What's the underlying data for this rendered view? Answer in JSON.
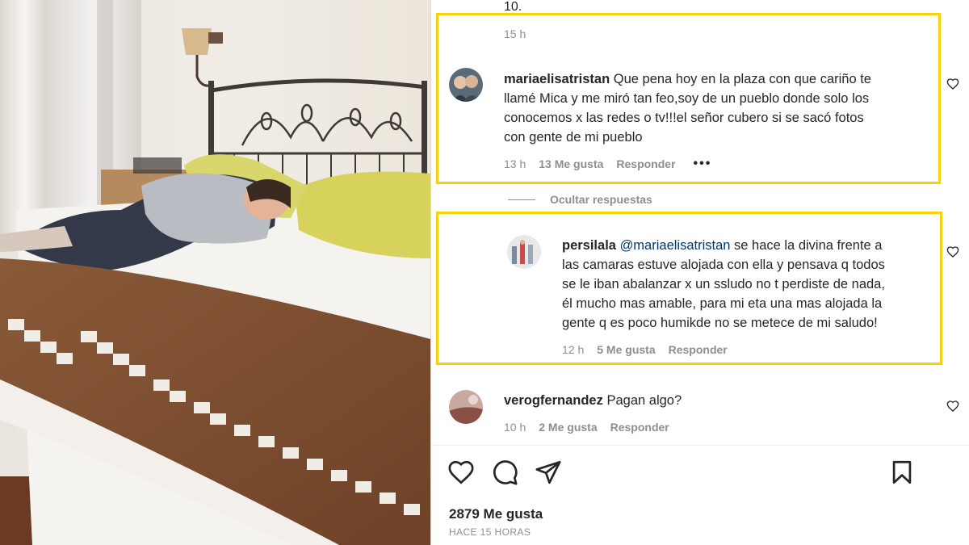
{
  "previous_comment": {
    "text_tail": "10.",
    "time": "15 h"
  },
  "comments": [
    {
      "username": "mariaelisatristan",
      "text": "Que pena hoy en la plaza con que cariño te llamé Mica y me miró tan feo,soy de un pueblo donde solo los conocemos x las redes o tv!!!el señor cubero si se sacó fotos con gente de mi pueblo",
      "lines": [
        "Que pena hoy en la plaza con que cariño te",
        "llamé Mica y me miró tan feo,soy de un pueblo donde solo los",
        "conocemos x las redes o tv!!!el señor cubero si se sacó fotos",
        "con gente de mi pueblo"
      ],
      "time": "13 h",
      "likes": "13 Me gusta",
      "reply_label": "Responder",
      "more": "•••"
    }
  ],
  "hide_replies_label": "Ocultar respuestas",
  "reply": {
    "username": "persilala",
    "mention": "@mariaelisatristan",
    "lines": [
      " se hace la divina frente a",
      "las camaras estuve alojada con ella y pensava q todos",
      "se le iban abalanzar x un ssludo no t perdiste de nada,",
      "él mucho mas amable, para mi eta una mas alojada la",
      "gente q es poco humikde no se metece de mi saludo!"
    ],
    "time": "12 h",
    "likes": "5 Me gusta",
    "reply_label": "Responder"
  },
  "third_comment": {
    "username": "verogfernandez",
    "text": "Pagan algo?",
    "time": "10 h",
    "likes": "2 Me gusta",
    "reply_label": "Responder"
  },
  "icons": [
    "heart-icon",
    "comment-icon",
    "share-icon",
    "bookmark-icon"
  ],
  "post": {
    "likes": "2879 Me gusta",
    "posted_ago": "HACE 15 HORAS"
  },
  "colors": {
    "highlight": "#f5d20d",
    "muted": "#8e8e8e",
    "text": "#262626",
    "mention": "#00376b"
  }
}
